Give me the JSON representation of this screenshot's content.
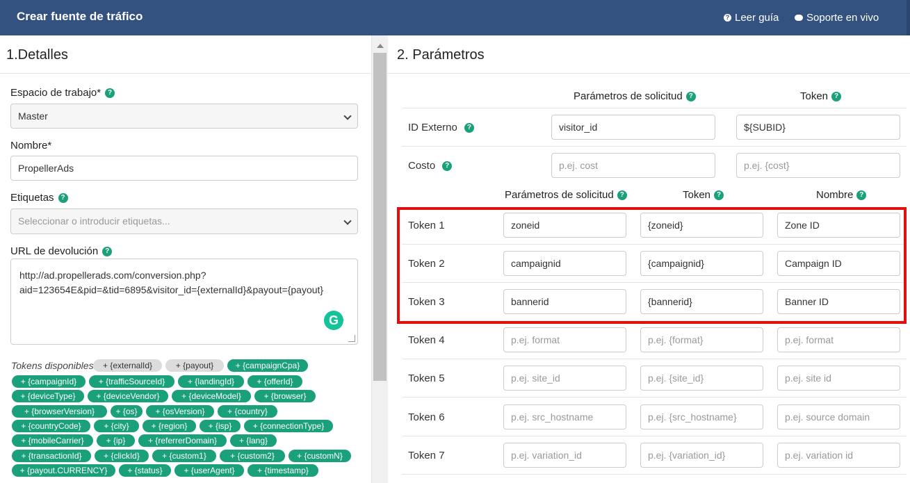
{
  "header": {
    "title": "Crear fuente de tráfico",
    "guide_link": "Leer guía",
    "support_link": "Soporte en vivo"
  },
  "details": {
    "section_title": "1.Detalles",
    "workspace": {
      "label": "Espacio de trabajo*",
      "value": "Master"
    },
    "name": {
      "label": "Nombre*",
      "value": "PropellerAds"
    },
    "tags": {
      "label": "Etiquetas",
      "placeholder": "Seleccionar o introducir etiquetas..."
    },
    "postback": {
      "label": "URL de devolución",
      "line1": "http://ad.propellerads.com/conversion.php?",
      "line2": "aid=123654E&pid=&tid=6895&visitor_id={externalId}&payout={payout}"
    },
    "tokens_label": "Tokens disponibles:",
    "tokens": [
      "+ {externalId}",
      "+ {payout}",
      "+ {campaignCpa}",
      "+ {campaignId}",
      "+ {trafficSourceId}",
      "+ {landingId}",
      "+ {offerId}",
      "+ {deviceType}",
      "+ {deviceVendor}",
      "+ {deviceModel}",
      "+ {browser}",
      "+ {browserVersion}",
      "+ {os}",
      "+ {osVersion}",
      "+ {country}",
      "+ {countryCode}",
      "+ {city}",
      "+ {region}",
      "+ {isp}",
      "+ {connectionType}",
      "+ {mobileCarrier}",
      "+ {ip}",
      "+ {referrerDomain}",
      "+ {lang}",
      "+ {transactionId}",
      "+ {clickId}",
      "+ {custom1}",
      "+ {custom2}",
      "+ {customN}",
      "+ {payout.CURRENCY}",
      "+ {status}",
      "+ {userAgent}",
      "+ {timestamp}"
    ]
  },
  "params": {
    "section_title": "2. Parámetros",
    "head1": {
      "request": "Parámetros de solicitud",
      "token": "Token"
    },
    "external": {
      "label": "ID Externo",
      "request": "visitor_id",
      "token": "${SUBID}"
    },
    "cost": {
      "label": "Costo",
      "request_placeholder": "p.ej. cost",
      "token_placeholder": "p.ej. {cost}"
    },
    "head2": {
      "request": "Parámetros de solicitud",
      "token": "Token",
      "name": "Nombre"
    },
    "rows": [
      {
        "label": "Token 1",
        "request": "zoneid",
        "token": "{zoneid}",
        "name": "Zone ID",
        "filled": true
      },
      {
        "label": "Token 2",
        "request": "campaignid",
        "token": "{campaignid}",
        "name": "Campaign ID",
        "filled": true
      },
      {
        "label": "Token 3",
        "request": "bannerid",
        "token": "{bannerid}",
        "name": "Banner ID",
        "filled": true
      },
      {
        "label": "Token 4",
        "request": "p.ej. format",
        "token": "p.ej. {format}",
        "name": "p.ej. format",
        "filled": false
      },
      {
        "label": "Token 5",
        "request": "p.ej. site_id",
        "token": "p.ej. {site_id}",
        "name": "p.ej. site id",
        "filled": false
      },
      {
        "label": "Token 6",
        "request": "p.ej. src_hostname",
        "token": "p.ej.  {src_hostname}",
        "name": "p.ej. source domain",
        "filled": false
      },
      {
        "label": "Token 7",
        "request": "p.ej. variation_id",
        "token": "p.ej. {variation_id}",
        "name": "p.ej. variation id",
        "filled": false
      }
    ]
  },
  "colors": {
    "header": "#34527f",
    "accent": "#1aa07a",
    "highlight": "#e01010"
  }
}
